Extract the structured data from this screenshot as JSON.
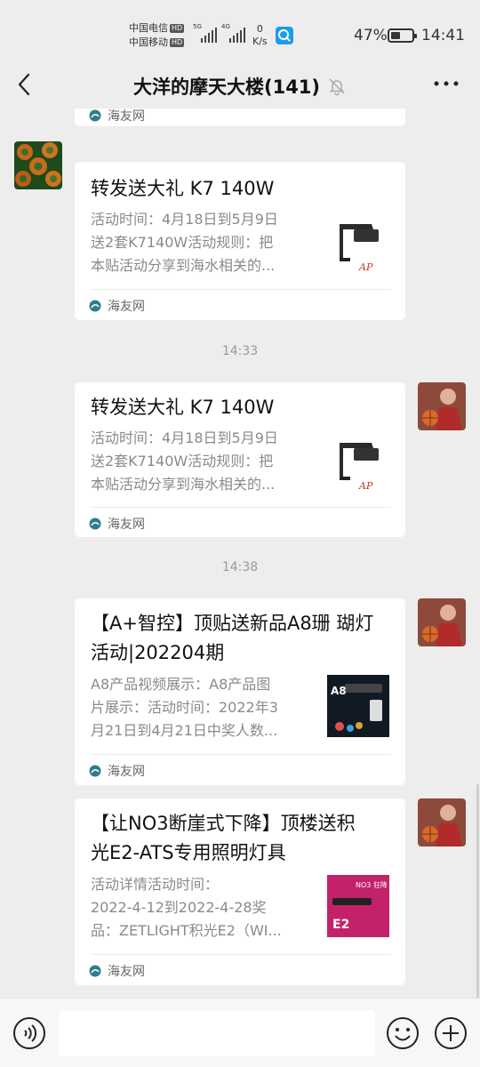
{
  "status_bar": {
    "carrier_1": "中国电信",
    "carrier_2": "中国移动",
    "hd": "HD",
    "net_1": "5G",
    "net_2": "4G",
    "speed_value": "0",
    "speed_unit": "K/s",
    "battery_percent": "47%",
    "battery_level": 0.47,
    "time": "14:41"
  },
  "header": {
    "title": "大洋的摩天大楼(141)",
    "muted": true
  },
  "messages": [
    {
      "sender": "other",
      "source": "海友网",
      "partial": true
    },
    {
      "sender": "other",
      "title": "转发送大礼 K7 140W",
      "desc_lines": [
        "活动时间：4月18日到5月9日",
        "送2套K7140W活动规则：把",
        "本贴活动分享到海水相关的..."
      ],
      "source": "海友网"
    },
    {
      "timestamp": "14:33"
    },
    {
      "sender": "self",
      "title": "转发送大礼 K7 140W",
      "desc_lines": [
        "活动时间：4月18日到5月9日",
        "送2套K7140W活动规则：把",
        "本贴活动分享到海水相关的..."
      ],
      "source": "海友网"
    },
    {
      "timestamp": "14:38"
    },
    {
      "sender": "self",
      "title_lines": [
        "【A+智控】顶贴送新品A8珊 瑚灯",
        "活动|202204期"
      ],
      "desc_lines": [
        "A8产品视频展示：A8产品图",
        "片展示：活动时间：2022年3",
        "月21日到4月21日中奖人数..."
      ],
      "source": "海友网",
      "thumb_label": "A8"
    },
    {
      "sender": "self",
      "title_lines": [
        "【让NO3断崖式下降】顶楼送积",
        "光E2-ATS专用照明灯具"
      ],
      "desc_lines": [
        "活动详情活动时间：",
        "2022-4-12到2022-4-28奖",
        "品：ZETLIGHT积光E2（WI..."
      ],
      "source": "海友网",
      "thumb_label": "E2",
      "thumb_top_text": "NO3 狂降"
    }
  ],
  "colors": {
    "background": "#ededed",
    "card": "#ffffff",
    "muted_text": "#8a8a8a",
    "source_icon": "#2e7d8c"
  },
  "icons": {
    "back": "chevron-left-icon",
    "mute": "bell-off-icon",
    "more": "more-dots-icon",
    "voice": "voice-icon",
    "emoji": "emoji-icon",
    "plus": "plus-icon"
  }
}
